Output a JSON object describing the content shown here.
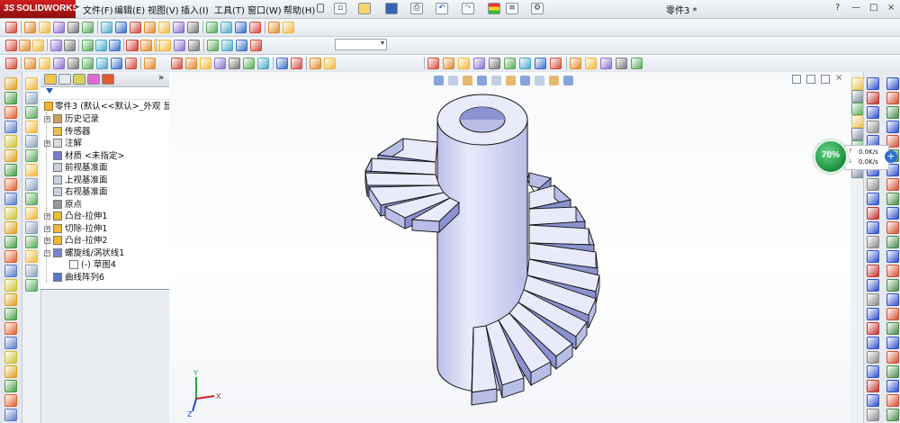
{
  "app": {
    "logo_prefix": "3S",
    "logo_text": "SOLIDWORKS",
    "document_title": "零件3 *"
  },
  "menu": {
    "items": [
      "文件(F)",
      "编辑(E)",
      "视图(V)",
      "插入(I)",
      "工具(T)",
      "窗口(W)",
      "帮助(H)"
    ],
    "more": "▸"
  },
  "window": {
    "help": "?",
    "minimize": "—",
    "restore": "□",
    "close": "×"
  },
  "feature_tree": {
    "collapse_arrow": "»",
    "root": "零件3  (默认<<默认>_外观 显",
    "items": [
      {
        "label": "历史记录",
        "icon": "history-icon",
        "expander": "+"
      },
      {
        "label": "传感器",
        "icon": "sensor-icon",
        "expander": ""
      },
      {
        "label": "注解",
        "icon": "annotation-icon",
        "expander": "+"
      },
      {
        "label": "材质 <未指定>",
        "icon": "material-icon",
        "expander": ""
      },
      {
        "label": "前视基准面",
        "icon": "plane-icon",
        "expander": ""
      },
      {
        "label": "上视基准面",
        "icon": "plane-icon",
        "expander": ""
      },
      {
        "label": "右视基准面",
        "icon": "plane-icon",
        "expander": ""
      },
      {
        "label": "原点",
        "icon": "origin-icon",
        "expander": ""
      },
      {
        "label": "凸台-拉伸1",
        "icon": "extrude-icon",
        "expander": "+"
      },
      {
        "label": "切除-拉伸1",
        "icon": "cut-icon",
        "expander": "+"
      },
      {
        "label": "凸台-拉伸2",
        "icon": "extrude-icon",
        "expander": "+"
      },
      {
        "label": "螺旋线/涡状线1",
        "icon": "helix-icon",
        "expander": "−"
      },
      {
        "label": "(-) 草图4",
        "icon": "sketch-icon",
        "expander": ""
      },
      {
        "label": "曲线阵列6",
        "icon": "pattern-icon",
        "expander": ""
      }
    ]
  },
  "triad": {
    "x_label": "X",
    "y_label": "Y",
    "z_label": "Z"
  },
  "net_meter": {
    "percent": "70%",
    "upload": "0.0K/s",
    "download": "0.0K/s",
    "plus": "+"
  },
  "colors": {
    "model_light": "#e9ebfb",
    "model_mid": "#b9bee8",
    "model_dark": "#8c92cf",
    "edge": "#141414",
    "triad_x": "#cc2222",
    "triad_y": "#22aa33",
    "triad_z": "#2244cc"
  }
}
